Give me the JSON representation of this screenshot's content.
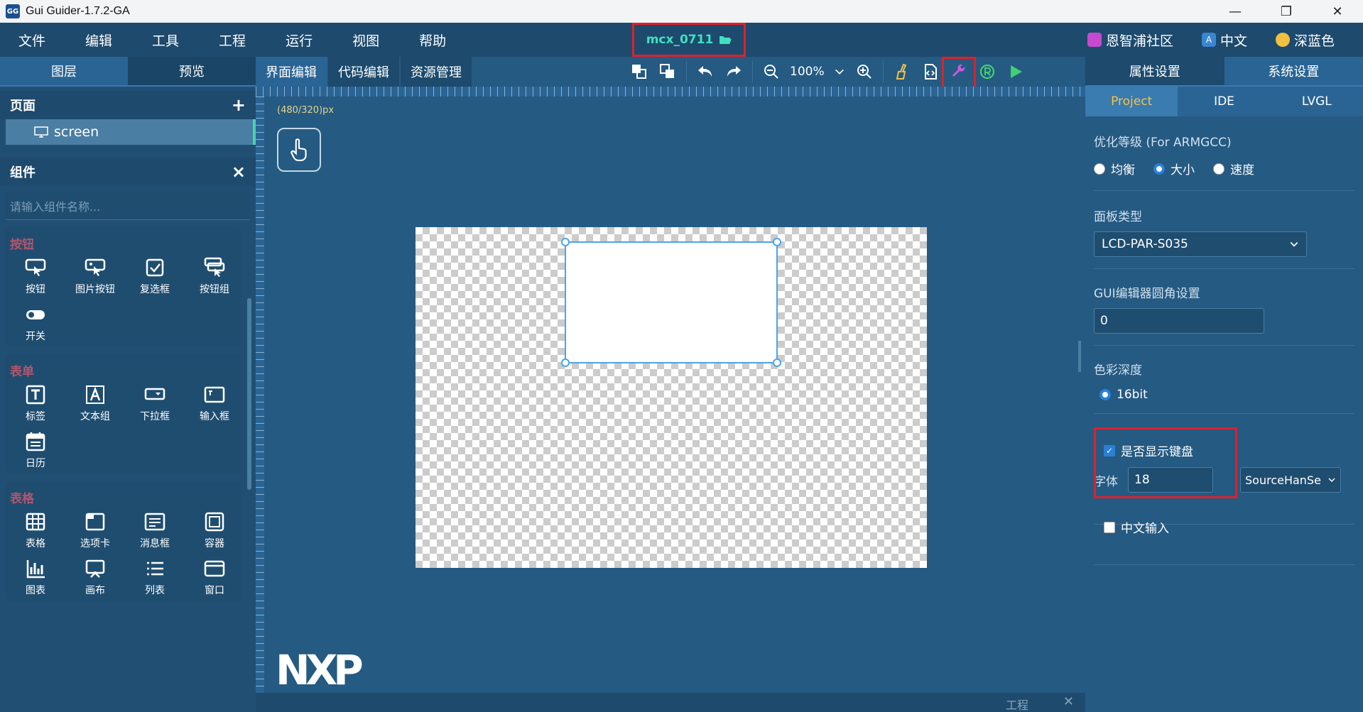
{
  "window": {
    "title": "Gui Guider-1.7.2-GA",
    "app_icon_text": "GG",
    "minimize": "—",
    "maximize": "❐",
    "close": "✕"
  },
  "menu": {
    "items": [
      "文件",
      "编辑",
      "工具",
      "工程",
      "运行",
      "视图",
      "帮助"
    ],
    "project_name": "mcx_0711",
    "right": {
      "community": "恩智浦社区",
      "language": "中文",
      "language_icon": "A",
      "theme": "深蓝色"
    }
  },
  "left": {
    "tabs": [
      "图层",
      "预览"
    ],
    "pages_header": "页面",
    "add": "+",
    "page_item": "screen",
    "widgets_header": "组件",
    "close": "×",
    "search_placeholder": "请输入组件名称...",
    "groups": [
      {
        "title": "按钮",
        "items": [
          "按钮",
          "图片按钮",
          "复选框",
          "按钮组",
          "开关"
        ]
      },
      {
        "title": "表单",
        "items": [
          "标签",
          "文本组",
          "下拉框",
          "输入框",
          "日历"
        ]
      },
      {
        "title": "表格",
        "items": [
          "表格",
          "选项卡",
          "消息框",
          "容器",
          "图表",
          "画布",
          "列表",
          "窗口"
        ]
      }
    ]
  },
  "center": {
    "tabs": [
      "界面编辑",
      "代码编辑",
      "资源管理"
    ],
    "zoom": "100%",
    "canvas_dims": "(480/320)px",
    "logo": "NXP",
    "bottom_label": "工程",
    "bottom_close": "✕"
  },
  "right": {
    "tabs": [
      "属性设置",
      "系统设置"
    ],
    "subtabs": [
      "Project",
      "IDE",
      "LVGL"
    ],
    "opt_label": "优化等级 (For ARMGCC)",
    "opt_options": [
      "均衡",
      "大小",
      "速度"
    ],
    "opt_selected": "大小",
    "panel_label": "面板类型",
    "panel_value": "LCD-PAR-S035",
    "radius_label": "GUI编辑器圆角设置",
    "radius_value": "0",
    "color_label": "色彩深度",
    "color_value": "16bit",
    "keyboard_label": "是否显示键盘",
    "keyboard_checked": true,
    "font_label": "字体",
    "font_size": "18",
    "font_name": "SourceHanSe",
    "chinese_input_label": "中文输入",
    "chinese_input_checked": false
  },
  "colors": {
    "accent": "#46d5a8",
    "highlight": "#e0202a",
    "project_name": "#40e0c0",
    "selected_subtab": "#f2c34a"
  }
}
